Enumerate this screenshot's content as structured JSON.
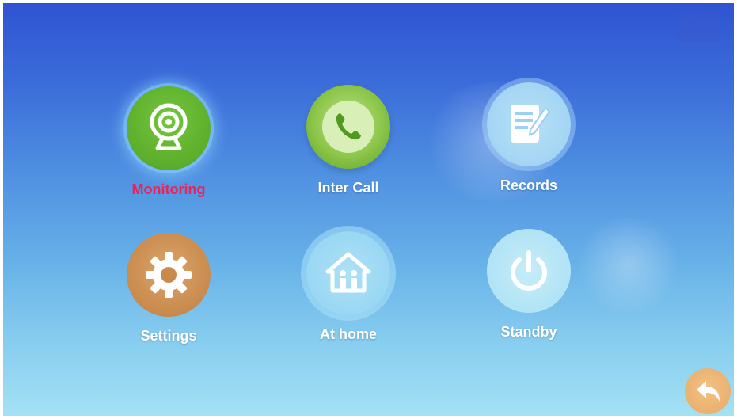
{
  "apps": [
    {
      "id": "monitoring",
      "label": "Monitoring",
      "icon": "webcam-icon",
      "selected": true
    },
    {
      "id": "inter-call",
      "label": "Inter Call",
      "icon": "phone-icon",
      "selected": false
    },
    {
      "id": "records",
      "label": "Records",
      "icon": "notepad-pen-icon",
      "selected": false
    },
    {
      "id": "settings",
      "label": "Settings",
      "icon": "gear-icon",
      "selected": false
    },
    {
      "id": "at-home",
      "label": "At home",
      "icon": "house-family-icon",
      "selected": false
    },
    {
      "id": "standby",
      "label": "Standby",
      "icon": "power-icon",
      "selected": false
    }
  ],
  "back_button": {
    "icon": "back-arrow-icon"
  },
  "colors": {
    "selected_label": "#e8245a",
    "label": "#ffffff",
    "monitoring": "#5cae2b",
    "inter_call": "#8cc64a",
    "settings": "#c98a4c",
    "back": "#e7a965"
  }
}
